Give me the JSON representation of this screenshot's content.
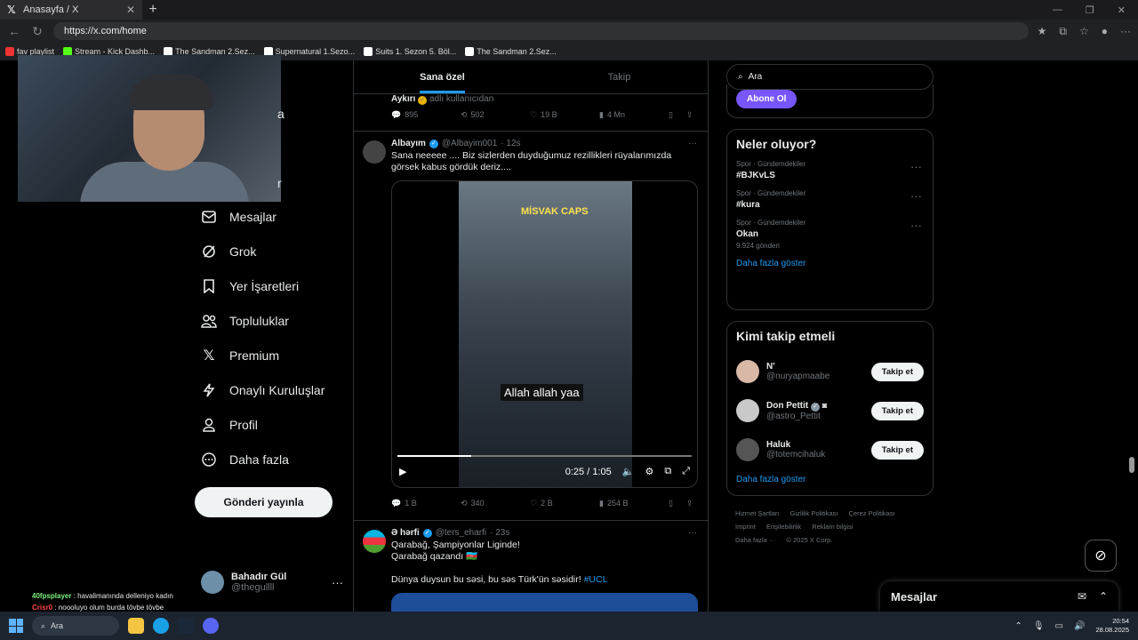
{
  "browser": {
    "tab_title": "Anasayfa / X",
    "url": "https://x.com/home",
    "bookmarks": [
      "fav playlist",
      "Stream - Kick Dashb...",
      "The Sandman 2.Sez...",
      "Supernatural 1.Sezo...",
      "Suits 1. Sezon 5. Böl...",
      "The Sandman 2.Sez..."
    ]
  },
  "sidebar": {
    "partial_label_1": "a",
    "partial_label_2": "r",
    "items": [
      {
        "label": "Mesajlar",
        "icon": "envelope-icon"
      },
      {
        "label": "Grok",
        "icon": "grok-icon"
      },
      {
        "label": "Yer İşaretleri",
        "icon": "bookmark-icon"
      },
      {
        "label": "Topluluklar",
        "icon": "communities-icon"
      },
      {
        "label": "Premium",
        "icon": "x-logo-icon"
      },
      {
        "label": "Onaylı Kuruluşlar",
        "icon": "lightning-icon"
      },
      {
        "label": "Profil",
        "icon": "person-icon"
      },
      {
        "label": "Daha fazla",
        "icon": "more-circle-icon"
      }
    ],
    "post_button": "Gönderi yayınla",
    "account": {
      "name": "Bahadır Gül",
      "handle": "@thegullll"
    }
  },
  "chat": [
    {
      "user": "40fpsplayer",
      "text": ": havalimanında delleniyo kadın"
    },
    {
      "user": "Crisr0",
      "text": ": noooluyo olum burda tövbe tövbe"
    }
  ],
  "timeline": {
    "tabs": [
      "Sana özel",
      "Takip"
    ],
    "prev_tweet": {
      "source": "Aykırı",
      "source_note": "adlı kullanıcıdan",
      "replies": "895",
      "reposts": "502",
      "likes": "19 B",
      "views": "4 Mn"
    },
    "tweet1": {
      "name": "Albayım",
      "handle": "@Albayim001",
      "time": "· 12s",
      "text": "Sana neeeee .... Biz sizlerden duyduğumuz rezillikleri rüyalarımızda görsek kabus gördük deriz....",
      "video_logo": "MİSVAK CAPS",
      "video_caption": "Allah allah yaa",
      "video_time": "0:25 / 1:05",
      "progress": 0.25,
      "replies": "1 B",
      "reposts": "340",
      "likes": "2 B",
      "views": "254 B"
    },
    "tweet2": {
      "name": "Ə hərfi",
      "handle": "@ters_eharfi",
      "time": "· 23s",
      "line1": "Qarabağ, Şampiyonlar Liginde!",
      "line2": "Qarabağ qazandı 🇦🇿",
      "line3": "Dünya duysun bu səsi, bu səs Türk'ün səsidir!",
      "hashtag": "#UCL"
    }
  },
  "right": {
    "search_placeholder": "Ara",
    "subscribe": "Abone Ol",
    "trends_title": "Neler oluyor?",
    "trends": [
      {
        "category": "Spor · Gündemdekiler",
        "title": "#BJKvLS",
        "count": ""
      },
      {
        "category": "Spor · Gündemdekiler",
        "title": "#kura",
        "count": ""
      },
      {
        "category": "Spor · Gündemdekiler",
        "title": "Okan",
        "count": "9.924 gönderi"
      }
    ],
    "show_more": "Daha fazla göster",
    "follow_title": "Kimi takip etmeli",
    "follow": [
      {
        "name": "N'",
        "handle": "@nuryapmaabe"
      },
      {
        "name": "Don Pettit",
        "handle": "@astro_Pettit"
      },
      {
        "name": "Haluk",
        "handle": "@totemcihaluk"
      }
    ],
    "follow_button": "Takip et",
    "footer": [
      "Hizmet Şartları",
      "Gizlilik Politikası",
      "Çerez Politikası",
      "Imprint",
      "Erişilebilirlik",
      "Reklam bilgisi",
      "Daha fazla ···",
      "© 2025 X Corp."
    ]
  },
  "messages_drawer": "Mesajlar",
  "taskbar": {
    "search": "Ara",
    "time": "20:54",
    "date": "28.08.2025"
  },
  "colors": {
    "accent": "#1d9bf0",
    "premium": "#7856ff",
    "bg": "#000000"
  }
}
